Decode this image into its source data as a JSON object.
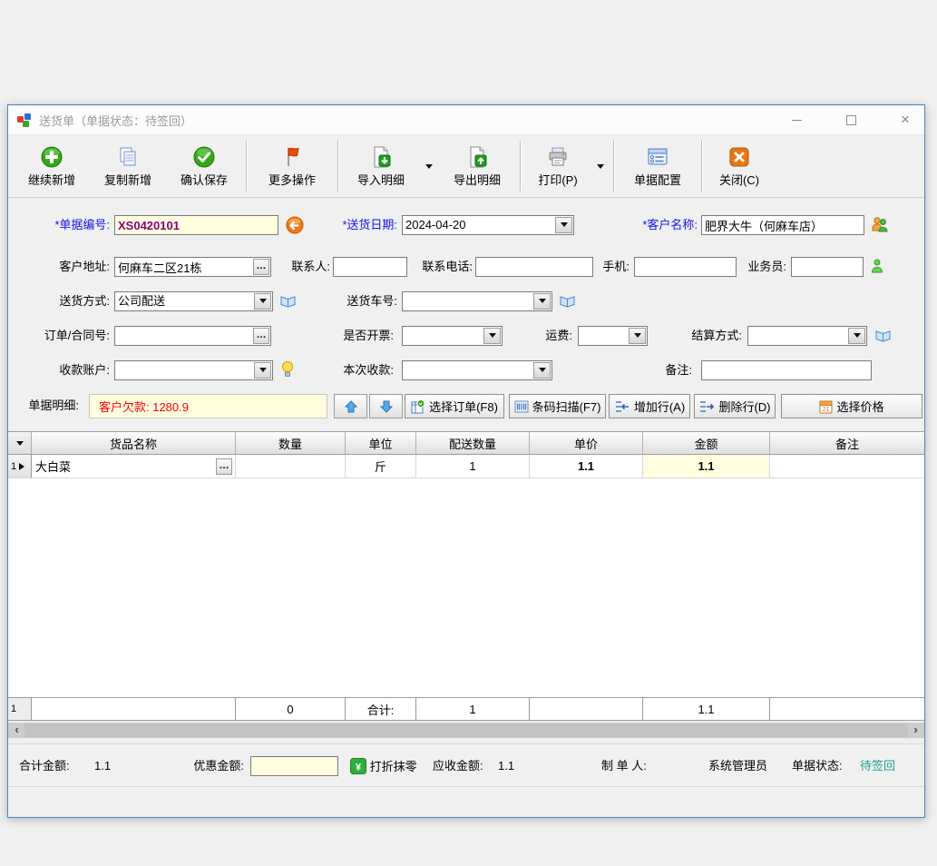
{
  "window": {
    "title": "送货单（单据状态：待签回）",
    "controls": {
      "minimize": "minimize-icon",
      "maximize": "maximize-icon",
      "close": "close-icon"
    }
  },
  "toolbar": {
    "buttons": [
      {
        "label": "继续新增",
        "icon": "plus-circle-icon"
      },
      {
        "label": "复制新增",
        "icon": "copy-icon"
      },
      {
        "label": "确认保存",
        "icon": "check-circle-icon"
      },
      {
        "label": "更多操作",
        "icon": "flag-icon"
      },
      {
        "label": "导入明细",
        "icon": "import-sheet-icon",
        "dropdown": true
      },
      {
        "label": "导出明细",
        "icon": "export-sheet-icon"
      },
      {
        "label": "打印(P)",
        "icon": "printer-icon",
        "dropdown": true
      },
      {
        "label": "单据配置",
        "icon": "doc-config-icon"
      },
      {
        "label": "关闭(C)",
        "icon": "close-square-icon"
      }
    ]
  },
  "form": {
    "doc_no": {
      "label": "*单据编号:",
      "value": "XS0420101"
    },
    "delivery_date": {
      "label": "*送货日期:",
      "value": "2024-04-20"
    },
    "customer_name": {
      "label": "*客户名称:",
      "value": "肥界大牛（何麻车店）"
    },
    "customer_address": {
      "label": "客户地址:",
      "value": "何麻车二区21栋"
    },
    "contact": {
      "label": "联系人:",
      "value": ""
    },
    "contact_phone": {
      "label": "联系电话:",
      "value": ""
    },
    "mobile": {
      "label": "手机:",
      "value": ""
    },
    "salesman": {
      "label": "业务员:",
      "value": ""
    },
    "delivery_method": {
      "label": "送货方式:",
      "value": "公司配送"
    },
    "vehicle_no": {
      "label": "送货车号:",
      "value": ""
    },
    "order_no": {
      "label": "订单/合同号:",
      "value": ""
    },
    "invoice_flag": {
      "label": "是否开票:",
      "value": ""
    },
    "freight": {
      "label": "运费:",
      "value": ""
    },
    "settlement": {
      "label": "结算方式:",
      "value": ""
    },
    "receive_account": {
      "label": "收款账户:",
      "value": ""
    },
    "current_receipt": {
      "label": "本次收款:",
      "value": ""
    },
    "remark": {
      "label": "备注:",
      "value": ""
    }
  },
  "detail_bar": {
    "label": "单据明细:",
    "debt_notice": "客户欠款: 1280.9",
    "buttons": [
      {
        "label": "选择订单(F8)",
        "icon": "select-order-icon"
      },
      {
        "label": "条码扫描(F7)",
        "icon": "barcode-icon"
      },
      {
        "label": "增加行(A)",
        "icon": "add-row-icon"
      },
      {
        "label": "删除行(D)",
        "icon": "delete-row-icon"
      },
      {
        "label": "选择价格",
        "icon": "price-calendar-icon"
      }
    ]
  },
  "detail_table": {
    "columns": [
      "货品名称",
      "数量",
      "单位",
      "配送数量",
      "单价",
      "金额",
      "备注"
    ],
    "rows": [
      {
        "index": "1",
        "name": "大白菜",
        "qty": "",
        "unit": "斤",
        "delivery_qty": "1",
        "price": "1.1",
        "amount": "1.1",
        "remark": ""
      }
    ],
    "summary": {
      "index": "1",
      "name": "",
      "qty": "0",
      "unit": "合计:",
      "delivery_qty": "1",
      "price": "",
      "amount": "1.1",
      "remark": ""
    }
  },
  "footer": {
    "total_label": "合计金额:",
    "total_value": "1.1",
    "discount_label": "优惠金额:",
    "discount_value": "",
    "round_button": "打折抹零",
    "receivable_label": "应收金额:",
    "receivable_value": "1.1",
    "maker_label": "制 单 人:",
    "maker_value": "系统管理员",
    "status_label": "单据状态:",
    "status_value": "待签回"
  },
  "colors": {
    "required_label": "#1414e6",
    "doc_no_value": "#800080",
    "debt_text": "#ff0000",
    "highlight_bg": "#ffffe0",
    "status_value": "#1fa094",
    "window_border": "#4a84c4"
  }
}
